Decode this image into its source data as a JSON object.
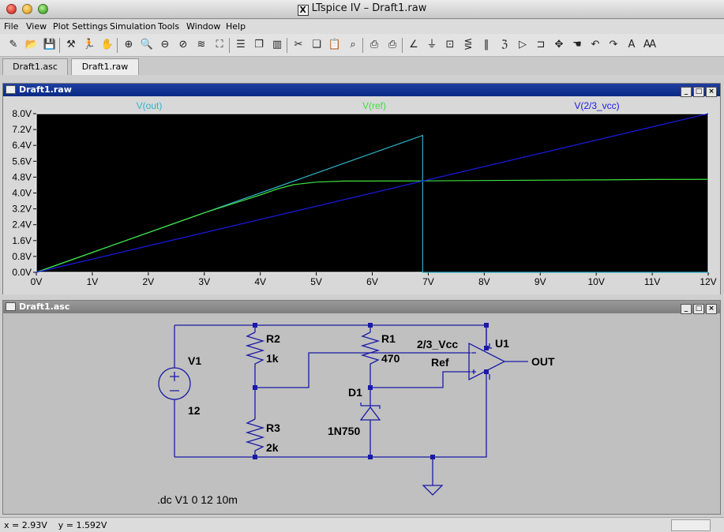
{
  "app": {
    "title": "LTspice IV – Draft1.raw",
    "x_icon": "X"
  },
  "menu": [
    "File",
    "View",
    "Plot Settings",
    "Simulation",
    "Tools",
    "Window",
    "Help"
  ],
  "toolbar_icons": [
    "new-schematic-icon",
    "open-icon",
    "save-icon",
    "control-panel-icon",
    "run-icon",
    "pan-icon",
    "zoom-in-icon",
    "zoom-box-icon",
    "zoom-out-icon",
    "zoom-cancel-icon",
    "autorange-icon",
    "zoom-fit-icon",
    "tile-horizontal-icon",
    "cascade-icon",
    "tile-vertical-icon",
    "cut-icon",
    "copy-icon",
    "paste-icon",
    "find-icon",
    "print-setup-icon",
    "print-icon",
    "wire-icon",
    "ground-icon",
    "label-net-icon",
    "resistor-icon",
    "capacitor-icon",
    "inductor-icon",
    "diode-icon",
    "component-icon",
    "move-icon",
    "drag-icon",
    "undo-icon",
    "redo-icon",
    "text-icon",
    "spice-directive-icon"
  ],
  "tabs": [
    {
      "label": "Draft1.asc",
      "active": false
    },
    {
      "label": "Draft1.raw",
      "active": true
    }
  ],
  "waveform_window": {
    "title": "Draft1.raw",
    "buttons": [
      "_",
      "□",
      "×"
    ]
  },
  "schematic_window": {
    "title": "Draft1.asc",
    "buttons": [
      "_",
      "□",
      "×"
    ]
  },
  "chart_data": {
    "type": "line",
    "background": "#000000",
    "x_label_unit": "V",
    "xlim": [
      0,
      12
    ],
    "ylim": [
      0,
      8
    ],
    "x_ticks": [
      "0V",
      "1V",
      "2V",
      "3V",
      "4V",
      "5V",
      "6V",
      "7V",
      "8V",
      "9V",
      "10V",
      "11V",
      "12V"
    ],
    "y_ticks": [
      "0.0V",
      "0.8V",
      "1.6V",
      "2.4V",
      "3.2V",
      "4.0V",
      "4.8V",
      "5.6V",
      "6.4V",
      "7.2V",
      "8.0V"
    ],
    "series": [
      {
        "name": "V(out)",
        "color": "#2fb5c8",
        "points": [
          [
            0,
            0
          ],
          [
            6.9,
            6.9
          ],
          [
            6.9,
            0
          ],
          [
            12,
            0
          ]
        ]
      },
      {
        "name": "V(ref)",
        "color": "#3fe03f",
        "points": [
          [
            0,
            0
          ],
          [
            3,
            3.0
          ],
          [
            3.5,
            3.45
          ],
          [
            4,
            3.9
          ],
          [
            4.3,
            4.2
          ],
          [
            4.6,
            4.42
          ],
          [
            5,
            4.55
          ],
          [
            5.5,
            4.6
          ],
          [
            6.9,
            4.61
          ],
          [
            8,
            4.63
          ],
          [
            10,
            4.66
          ],
          [
            11,
            4.68
          ],
          [
            12,
            4.69
          ]
        ]
      },
      {
        "name": "V(2/3_vcc)",
        "color": "#1a1ae6",
        "points": [
          [
            0,
            0
          ],
          [
            12,
            8.0
          ]
        ]
      }
    ]
  },
  "schematic": {
    "components": {
      "V1": {
        "name": "V1",
        "value": "12"
      },
      "R2": {
        "name": "R2",
        "value": "1k"
      },
      "R3": {
        "name": "R3",
        "value": "2k"
      },
      "R1": {
        "name": "R1",
        "value": "470"
      },
      "D1": {
        "name": "D1",
        "value": "1N750"
      },
      "U1": {
        "name": "U1"
      }
    },
    "nets": {
      "vcc": "2/3_Vcc",
      "ref": "Ref",
      "out": "OUT"
    },
    "directive": ".dc V1 0 12 10m"
  },
  "status": {
    "coords": "x = 2.93V    y = 1.592V"
  }
}
